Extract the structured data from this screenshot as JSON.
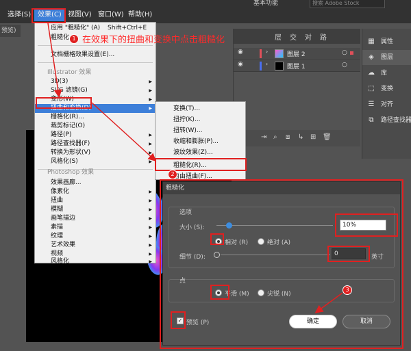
{
  "menubar": {
    "items": [
      "选择(S)",
      "效果(C)",
      "视图(V)",
      "窗口(W)",
      "帮助(H)"
    ],
    "workspace": "基本功能",
    "search_placeholder": "搜索 Adobe Stock"
  },
  "doc_tab": "预览)",
  "effect_menu": {
    "apply_last": "应用 \"粗糙化\" (A)",
    "apply_last_shortcut": "Shift+Ctrl+E",
    "last_effect": "粗糙化",
    "raster_settings": "文档栅格效果设置(E)...",
    "illustrator_header": "Illustrator 效果",
    "illustrator_items": [
      "3D(3)",
      "SVG 滤镜(G)",
      "变形(W)",
      "扭曲和变换(D)",
      "栅格化(R)...",
      "裁剪标记(O)",
      "路径(P)",
      "路径查找器(F)",
      "转换为形状(V)",
      "风格化(S)"
    ],
    "photoshop_header": "Photoshop 效果",
    "photoshop_items": [
      "效果画廊...",
      "像素化",
      "扭曲",
      "模糊",
      "画笔描边",
      "素描",
      "纹理",
      "艺术效果",
      "视频",
      "风格化"
    ]
  },
  "submenu": {
    "items": [
      "变换(T)...",
      "扭拧(K)...",
      "扭转(W)...",
      "收缩和膨胀(P)...",
      "波纹效果(Z)...",
      "粗糙化(R)...",
      "自由扭曲(F)..."
    ]
  },
  "layers_panel": {
    "tabs": [
      "层",
      "交",
      "对",
      "路"
    ],
    "layers": [
      {
        "name": "图层 2",
        "color": "#e0505a"
      },
      {
        "name": "图层 1",
        "color": "#4a6ef0"
      }
    ]
  },
  "right_panel": {
    "items": [
      {
        "icon": "properties-icon",
        "glyph": "▦",
        "label": "属性"
      },
      {
        "icon": "layers-icon",
        "glyph": "◈",
        "label": "图层"
      },
      {
        "icon": "libraries-icon",
        "glyph": "☁",
        "label": "库"
      },
      {
        "icon": "transform-icon",
        "glyph": "⬚",
        "label": "变换"
      },
      {
        "icon": "align-icon",
        "glyph": "☰",
        "label": "对齐"
      },
      {
        "icon": "pathfinder-icon",
        "glyph": "⧉",
        "label": "路径查找器"
      }
    ]
  },
  "dialog": {
    "title": "粗糙化",
    "options_label": "选项",
    "size_label": "大小 (S):",
    "size_value": "10%",
    "relative_label": "相对 (R)",
    "absolute_label": "绝对 (A)",
    "detail_label": "细节 (D):",
    "detail_value": "0",
    "detail_unit": "英寸",
    "points_label": "点",
    "smooth_label": "平滑 (M)",
    "corner_label": "尖锐 (N)",
    "preview_label": "预览 (P)",
    "ok_label": "确定",
    "cancel_label": "取消"
  },
  "annotation": {
    "note": "在效果下的扭曲和变换中点击粗糙化",
    "badges": [
      "1",
      "2",
      "3"
    ],
    "color": "#e02020"
  }
}
